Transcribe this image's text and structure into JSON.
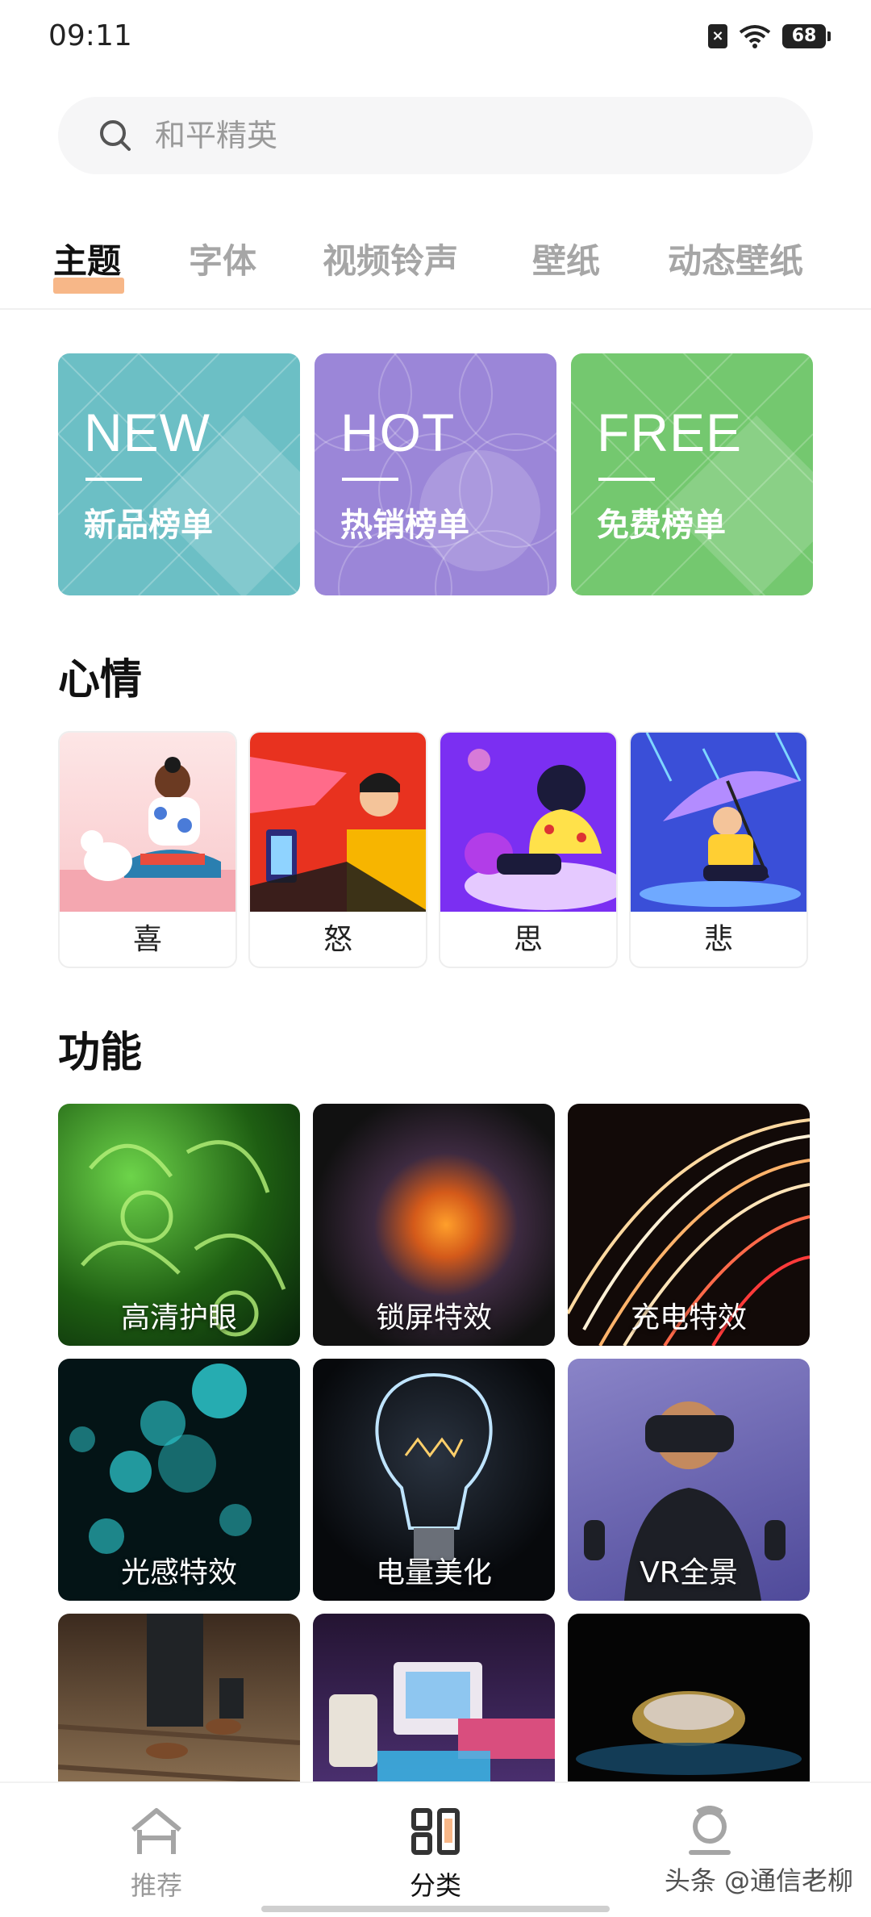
{
  "status_bar": {
    "time": "09:11",
    "battery": "68"
  },
  "search": {
    "placeholder": "和平精英"
  },
  "tabs": [
    {
      "label": "主题"
    },
    {
      "label": "字体"
    },
    {
      "label": "视频铃声"
    },
    {
      "label": "壁纸"
    },
    {
      "label": "动态壁纸"
    }
  ],
  "active_tab": "主题",
  "rank_cards": [
    {
      "en": "NEW",
      "cn": "新品榜单",
      "color": "#6cbfc5"
    },
    {
      "en": "HOT",
      "cn": "热销榜单",
      "color": "#9b86d8"
    },
    {
      "en": "FREE",
      "cn": "免费榜单",
      "color": "#74c86f"
    }
  ],
  "mood_section": {
    "title": "心情",
    "items": [
      {
        "label": "喜"
      },
      {
        "label": "怒"
      },
      {
        "label": "思"
      },
      {
        "label": "悲"
      }
    ]
  },
  "function_section": {
    "title": "功能",
    "items": [
      {
        "label": "高清护眼"
      },
      {
        "label": "锁屏特效"
      },
      {
        "label": "充电特效"
      },
      {
        "label": "光感特效"
      },
      {
        "label": "电量美化"
      },
      {
        "label": "VR全景"
      },
      {
        "label": ""
      },
      {
        "label": ""
      },
      {
        "label": ""
      }
    ]
  },
  "bottom_nav": [
    {
      "label": "推荐",
      "icon": "home-icon"
    },
    {
      "label": "分类",
      "icon": "category-icon"
    },
    {
      "label": "",
      "icon": "profile-icon"
    }
  ],
  "watermark": "头条 @通信老柳",
  "colors": {
    "accent": "#f7b788"
  }
}
